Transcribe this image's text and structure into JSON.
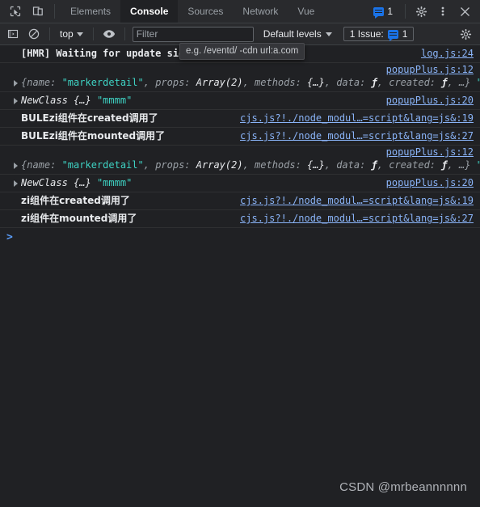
{
  "tabbar": {
    "inspect_icon": "inspect-cursor-icon",
    "device_icon": "device-toolbar-icon",
    "tabs": [
      {
        "label": "Elements",
        "active": false
      },
      {
        "label": "Console",
        "active": true
      },
      {
        "label": "Sources",
        "active": false
      },
      {
        "label": "Network",
        "active": false
      },
      {
        "label": "Vue",
        "active": false
      }
    ],
    "issue_count": "1",
    "settings_icon": "gear-icon",
    "more_icon": "kebab-menu-icon",
    "close_icon": "close-icon"
  },
  "filterbar": {
    "sidebar_icon": "console-sidebar-icon",
    "clear_icon": "clear-console-icon",
    "context": "top",
    "eye_icon": "live-expression-eye-icon",
    "filter_value": "",
    "filter_placeholder": "Filter",
    "filter_hint": "e.g. /eventd/ -cdn url:a.com",
    "levels": "Default levels",
    "issues_label": "1 Issue:",
    "issues_count": "1",
    "settings_icon": "gear-icon"
  },
  "console": {
    "messages": [
      {
        "kind": "text",
        "text": "[HMR] Waiting for update signal from WDS...",
        "source": "log.js:24"
      },
      {
        "kind": "object",
        "source": "popupPlus.js:12",
        "parts": [
          {
            "t": "{name: ",
            "c": "prop"
          },
          {
            "t": "\"markerdetail\"",
            "c": "str"
          },
          {
            "t": ", ",
            "c": "prop"
          },
          {
            "t": "props: ",
            "c": "prop"
          },
          {
            "t": "Array(2)",
            "c": "name"
          },
          {
            "t": ", ",
            "c": "prop"
          },
          {
            "t": "methods: ",
            "c": "prop"
          },
          {
            "t": "{…}",
            "c": "name"
          },
          {
            "t": ", ",
            "c": "prop"
          },
          {
            "t": "data: ",
            "c": "prop"
          },
          {
            "t": "ƒ",
            "c": "fn"
          },
          {
            "t": ", ",
            "c": "prop"
          },
          {
            "t": "created: ",
            "c": "prop"
          },
          {
            "t": "ƒ",
            "c": "fn"
          },
          {
            "t": ", …}",
            "c": "prop"
          },
          {
            "t": " \"t\"",
            "c": "str"
          }
        ]
      },
      {
        "kind": "object-short",
        "source": "popupPlus.js:20",
        "parts": [
          {
            "t": "NewClass ",
            "c": "name"
          },
          {
            "t": "{…}",
            "c": "name"
          },
          {
            "t": " \"mmmm\"",
            "c": "str"
          }
        ]
      },
      {
        "kind": "cn",
        "text": "BULEzi组件在created调用了",
        "source": "cjs.js?!./node_modul…=script&lang=js&:19"
      },
      {
        "kind": "cn",
        "text": "BULEzi组件在mounted调用了",
        "source": "cjs.js?!./node_modul…=script&lang=js&:27"
      },
      {
        "kind": "object",
        "source": "popupPlus.js:12",
        "parts": [
          {
            "t": "{name: ",
            "c": "prop"
          },
          {
            "t": "\"markerdetail\"",
            "c": "str"
          },
          {
            "t": ", ",
            "c": "prop"
          },
          {
            "t": "props: ",
            "c": "prop"
          },
          {
            "t": "Array(2)",
            "c": "name"
          },
          {
            "t": ", ",
            "c": "prop"
          },
          {
            "t": "methods: ",
            "c": "prop"
          },
          {
            "t": "{…}",
            "c": "name"
          },
          {
            "t": ", ",
            "c": "prop"
          },
          {
            "t": "data: ",
            "c": "prop"
          },
          {
            "t": "ƒ",
            "c": "fn"
          },
          {
            "t": ", ",
            "c": "prop"
          },
          {
            "t": "created: ",
            "c": "prop"
          },
          {
            "t": "ƒ",
            "c": "fn"
          },
          {
            "t": ", …}",
            "c": "prop"
          },
          {
            "t": " \"t\"",
            "c": "str"
          }
        ]
      },
      {
        "kind": "object-short",
        "source": "popupPlus.js:20",
        "parts": [
          {
            "t": "NewClass ",
            "c": "name"
          },
          {
            "t": "{…}",
            "c": "name"
          },
          {
            "t": " \"mmmm\"",
            "c": "str"
          }
        ]
      },
      {
        "kind": "cn",
        "text": "zi组件在created调用了",
        "source": "cjs.js?!./node_modul…=script&lang=js&:19"
      },
      {
        "kind": "cn",
        "text": "zi组件在mounted调用了",
        "source": "cjs.js?!./node_modul…=script&lang=js&:27"
      }
    ],
    "prompt_symbol": ">"
  },
  "watermark": "CSDN @mrbeannnnnn",
  "colors": {
    "background": "#202124",
    "toolbar": "#292a2d",
    "link": "#8ab4f8",
    "string": "#3ed2c3",
    "accent": "#1a73e8"
  }
}
